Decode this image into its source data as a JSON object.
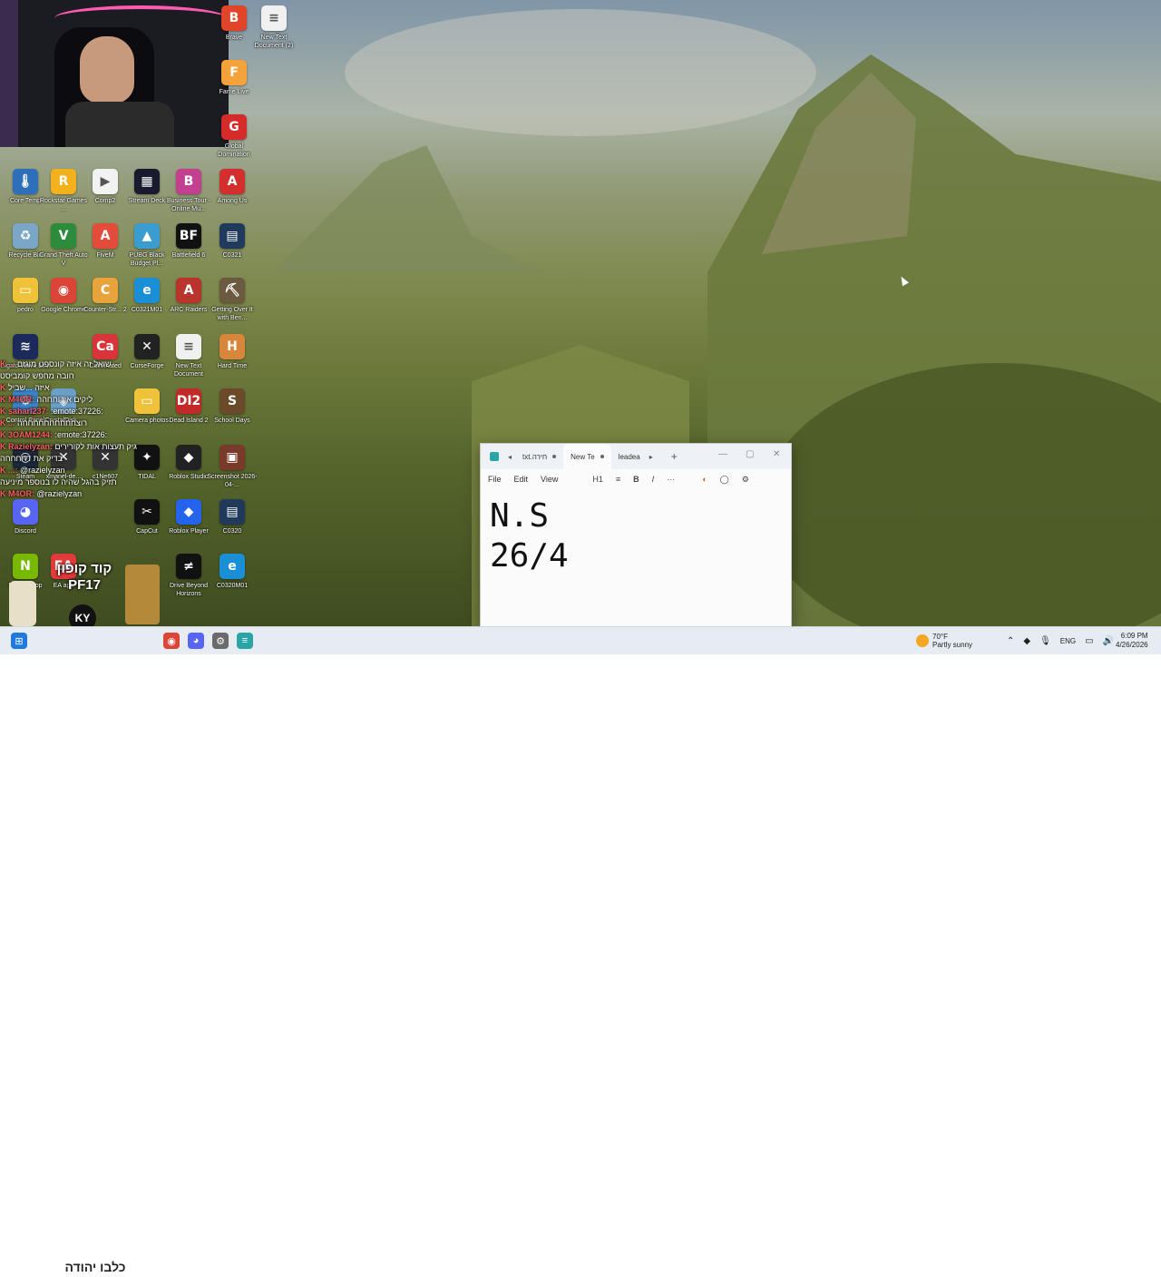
{
  "desktop": {
    "icons": [
      {
        "id": "brave",
        "label": "Brave",
        "glyph": "B",
        "color": "#e0452a"
      },
      {
        "id": "new-text-document-2",
        "label": "New Text Document (2)",
        "glyph": "≡",
        "color": "#f0f0f0"
      },
      {
        "id": "fame-live",
        "label": "Fame Live",
        "glyph": "F",
        "color": "#f4a23a"
      },
      {
        "id": "global-domination",
        "label": "Global Domination",
        "glyph": "G",
        "color": "#d52b2b"
      },
      {
        "id": "core-temp",
        "label": "Core Temp",
        "glyph": "🌡",
        "color": "#2d6fb8"
      },
      {
        "id": "rockstar-games",
        "label": "Rockstar Games ...",
        "glyph": "R",
        "color": "#f3b21b"
      },
      {
        "id": "comp2",
        "label": "Comp2",
        "glyph": "▶",
        "color": "#f2f2f2"
      },
      {
        "id": "stream-deck",
        "label": "Stream Deck",
        "glyph": "▦",
        "color": "#1a1a2e"
      },
      {
        "id": "business-tour",
        "label": "Business Tour - Online Mu...",
        "glyph": "B",
        "color": "#c2408f"
      },
      {
        "id": "among-us",
        "label": "Among Us",
        "glyph": "A",
        "color": "#d32f2f"
      },
      {
        "id": "recycle-bin",
        "label": "Recycle Bin",
        "glyph": "♻",
        "color": "#7aa7c7"
      },
      {
        "id": "gta5",
        "label": "Grand Theft Auto V",
        "glyph": "V",
        "color": "#2d8b3c"
      },
      {
        "id": "fivem",
        "label": "FiveM",
        "glyph": "A",
        "color": "#e34c3a"
      },
      {
        "id": "pubg",
        "label": "PUBG Black Budget Pl...",
        "glyph": "▲",
        "color": "#3a9ccf"
      },
      {
        "id": "battlefield6",
        "label": "Battlefield 6",
        "glyph": "BF",
        "color": "#111111"
      },
      {
        "id": "c0321",
        "label": "C0321",
        "glyph": "▤",
        "color": "#1f3a5a"
      },
      {
        "id": "pedro",
        "label": "pedro",
        "glyph": "▭",
        "color": "#f0c23a"
      },
      {
        "id": "google-chrome",
        "label": "Google Chrome",
        "glyph": "◉",
        "color": "#db4437"
      },
      {
        "id": "counter-strike2",
        "label": "Counter-Str... 2",
        "glyph": "C",
        "color": "#e8a33a"
      },
      {
        "id": "c0321m01",
        "label": "C0321M01",
        "glyph": "e",
        "color": "#1a8fd6"
      },
      {
        "id": "arc-raiders",
        "label": "ARC Raiders",
        "glyph": "A",
        "color": "#b9342c"
      },
      {
        "id": "getting-over-it",
        "label": "Getting Over It with Ben...",
        "glyph": "⛏",
        "color": "#6b5a40"
      },
      {
        "id": "elgato-wave-link",
        "label": "Elgato Wave Link",
        "glyph": "≋",
        "color": "#1b2a5a"
      },
      {
        "id": "caffeinated",
        "label": "Caffeinated",
        "glyph": "Ca",
        "color": "#d9343a"
      },
      {
        "id": "curseforge",
        "label": "CurseForge",
        "glyph": "✕",
        "color": "#222222"
      },
      {
        "id": "new-text-document",
        "label": "New Text Document",
        "glyph": "≡",
        "color": "#f0f0f0"
      },
      {
        "id": "hard-time",
        "label": "Hard Time",
        "glyph": "H",
        "color": "#d8873a"
      },
      {
        "id": "control-panel",
        "label": "Control Panel",
        "glyph": "⚙",
        "color": "#3b82c4"
      },
      {
        "id": "crystal-disk",
        "label": "CrystalDisk...",
        "glyph": "◈",
        "color": "#6aa0c8"
      },
      {
        "id": "camera-photos",
        "label": "Camera photos",
        "glyph": "▭",
        "color": "#f0c23a"
      },
      {
        "id": "dead-island2",
        "label": "Dead Island 2",
        "glyph": "DI2",
        "color": "#c22a2a"
      },
      {
        "id": "school-days",
        "label": "School Days",
        "glyph": "S",
        "color": "#6a4a2a"
      },
      {
        "id": "steam",
        "label": "Steam",
        "glyph": "◎",
        "color": "#1b2838"
      },
      {
        "id": "xmanel-de",
        "label": "xmanel-de...",
        "glyph": "✕",
        "color": "#333333"
      },
      {
        "id": "c1ne607",
        "label": "c1Ne607",
        "glyph": "✕",
        "color": "#333333"
      },
      {
        "id": "tidal",
        "label": "TIDAL",
        "glyph": "✦",
        "color": "#111111"
      },
      {
        "id": "roblox-studio",
        "label": "Roblox Studio",
        "glyph": "◆",
        "color": "#222222"
      },
      {
        "id": "screenshot",
        "label": "Screenshot 2026-04-...",
        "glyph": "▣",
        "color": "#7a3a2a"
      },
      {
        "id": "discord",
        "label": "Discord",
        "glyph": "◕",
        "color": "#5865f2"
      },
      {
        "id": "capcut",
        "label": "CapCut",
        "glyph": "✂",
        "color": "#111111"
      },
      {
        "id": "roblox-player",
        "label": "Roblox Player",
        "glyph": "◆",
        "color": "#2463eb"
      },
      {
        "id": "c0320",
        "label": "C0320",
        "glyph": "▤",
        "color": "#1f3a5a"
      },
      {
        "id": "nvidia-app",
        "label": "NVIDIA App",
        "glyph": "N",
        "color": "#76b900"
      },
      {
        "id": "ea-app",
        "label": "EA app",
        "glyph": "EA",
        "color": "#e23a3a"
      },
      {
        "id": "drive-beyond-horizons",
        "label": "Drive Beyond Horizons",
        "glyph": "≠",
        "color": "#111111"
      },
      {
        "id": "c0320m01",
        "label": "C0320M01",
        "glyph": "e",
        "color": "#1a8fd6"
      }
    ]
  },
  "chat": {
    "lines": [
      {
        "user": "K ...",
        "text": "שואל זה איזה קונספט מוגזם"
      },
      {
        "user": "",
        "text": "חובה מחפש קומביסט"
      },
      {
        "user": "K",
        "text": "איזה ...שביל"
      },
      {
        "user": "K M4OR:",
        "text": "ליקים אירוחחהה"
      },
      {
        "user": "K saharl237:",
        "text": ":emote:37226:"
      },
      {
        "user": "K ...",
        "text": "רוצחחחחחחחחחחה"
      },
      {
        "user": "K 3OAM1244:",
        "text": ":emote:37226:"
      },
      {
        "user": "K Razielyzan:",
        "text": "גיק תעצות אות לקורירים"
      },
      {
        "user": "",
        "text": "בדיק את דחחחחה"
      },
      {
        "user": "K ...:",
        "text": "@razielyzan"
      },
      {
        "user": "",
        "text": "תזיק בהגל שהיה לו בנוספר מיניעה"
      },
      {
        "user": "K M4OR:",
        "text": "@razielyzan"
      }
    ]
  },
  "overlay": {
    "promo_line1": "קוד קופון",
    "promo_line2": "PF17",
    "ky_badge": "KY",
    "banner_text": "כלבו יהודה"
  },
  "notepad": {
    "tabs": [
      {
        "label": "txt.חירה",
        "active": false
      },
      {
        "label": "New Te",
        "active": true
      },
      {
        "label": "leadea",
        "active": false
      }
    ],
    "new_tab_symbol": "+",
    "menu": {
      "file": "File",
      "edit": "Edit",
      "view": "View",
      "heading": "H1",
      "list": "≡",
      "bold": "B",
      "italic": "I",
      "more": "···"
    },
    "content_line1": "N.S",
    "content_line2": "26/4",
    "controls": {
      "minimize": "—",
      "maximize": "▢",
      "close": "✕"
    }
  },
  "taskbar": {
    "weather_temp": "70°F",
    "weather_desc": "Partly sunny",
    "language": "ENG",
    "time": "6:09 PM",
    "date": "4/26/2026"
  }
}
